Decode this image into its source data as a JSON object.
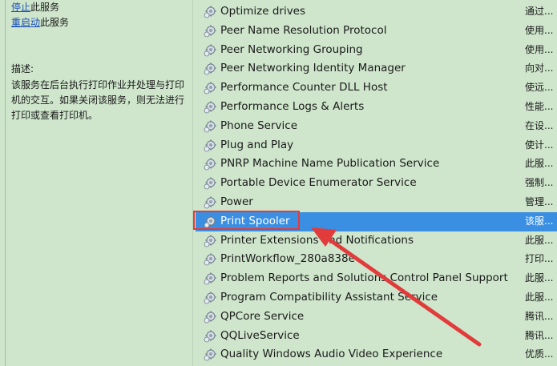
{
  "actions": [
    {
      "link": "停止",
      "rest": "此服务"
    },
    {
      "link": "重启动",
      "rest": "此服务"
    }
  ],
  "description": {
    "label": "描述:",
    "text": "该服务在后台执行打印作业并处理与打印机的交互。如果关闭该服务，则无法进行打印或查看打印机。"
  },
  "services": [
    {
      "name": "Optimize drives",
      "desc": "通过..."
    },
    {
      "name": "Peer Name Resolution Protocol",
      "desc": "使用..."
    },
    {
      "name": "Peer Networking Grouping",
      "desc": "使用..."
    },
    {
      "name": "Peer Networking Identity Manager",
      "desc": "向对..."
    },
    {
      "name": "Performance Counter DLL Host",
      "desc": "使远..."
    },
    {
      "name": "Performance Logs & Alerts",
      "desc": "性能..."
    },
    {
      "name": "Phone Service",
      "desc": "在设..."
    },
    {
      "name": "Plug and Play",
      "desc": "使计..."
    },
    {
      "name": "PNRP Machine Name Publication Service",
      "desc": "此服..."
    },
    {
      "name": "Portable Device Enumerator Service",
      "desc": "强制..."
    },
    {
      "name": "Power",
      "desc": "管理..."
    },
    {
      "name": "Print Spooler",
      "desc": "该服..."
    },
    {
      "name": "Printer Extensions and Notifications",
      "desc": "此服..."
    },
    {
      "name": "PrintWorkflow_280a838e",
      "desc": "打印..."
    },
    {
      "name": "Problem Reports and Solutions Control Panel Support",
      "desc": "此服..."
    },
    {
      "name": "Program Compatibility Assistant Service",
      "desc": "此服..."
    },
    {
      "name": "QPCore Service",
      "desc": "腾讯..."
    },
    {
      "name": "QQLiveService",
      "desc": "腾讯..."
    },
    {
      "name": "Quality Windows Audio Video Experience",
      "desc": "优质..."
    }
  ],
  "selected_service": "Print Spooler",
  "colors": {
    "background": "#cfe6cc",
    "selection": "#3a8fe3",
    "annotation": "#e23b3b",
    "link": "#1a4fb8"
  }
}
